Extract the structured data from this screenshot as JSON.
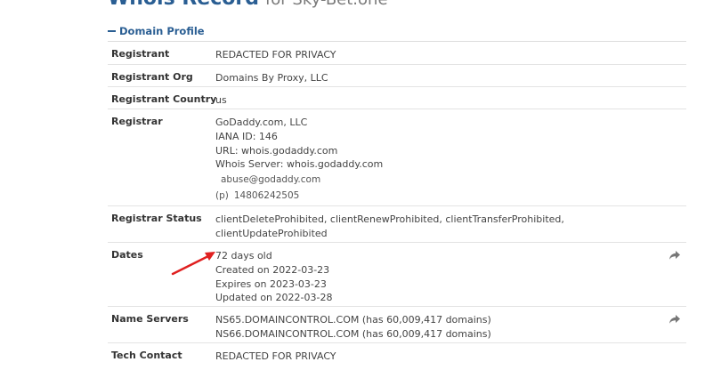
{
  "page": {
    "title_bold": "Whois Record",
    "title_rest": "for Sky-Bet.one"
  },
  "profile": {
    "header": "Domain Profile"
  },
  "rows": {
    "registrant": {
      "label": "Registrant",
      "value": "REDACTED FOR PRIVACY"
    },
    "registrant_org": {
      "label": "Registrant Org",
      "value": "Domains By Proxy, LLC"
    },
    "registrant_country": {
      "label": "Registrant Country",
      "value": "us"
    },
    "registrar": {
      "label": "Registrar",
      "lines": [
        "GoDaddy.com, LLC",
        "IANA ID: 146",
        "URL: whois.godaddy.com",
        "Whois Server: whois.godaddy.com"
      ],
      "email": "abuse@godaddy.com",
      "phone_prefix": "(p)",
      "phone": "14806242505"
    },
    "registrar_status": {
      "label": "Registrar Status",
      "lines": [
        "clientDeleteProhibited, clientRenewProhibited, clientTransferProhibited,",
        "clientUpdateProhibited"
      ]
    },
    "dates": {
      "label": "Dates",
      "lines": [
        "72 days old",
        "Created on 2022-03-23",
        "Expires on 2023-03-23",
        "Updated on 2022-03-28"
      ]
    },
    "name_servers": {
      "label": "Name Servers",
      "lines": [
        "NS65.DOMAINCONTROL.COM (has 60,009,417 domains)",
        "NS66.DOMAINCONTROL.COM (has 60,009,417 domains)"
      ]
    },
    "tech_contact": {
      "label": "Tech Contact",
      "value": "REDACTED FOR PRIVACY"
    }
  },
  "icons": {
    "share": "share-arrow-icon",
    "collapse": "minus-icon",
    "annotation": "red-arrow-annotation"
  },
  "colors": {
    "link_blue": "#2a5e93",
    "arrow_red": "#e02020",
    "share_gray": "#777777"
  }
}
